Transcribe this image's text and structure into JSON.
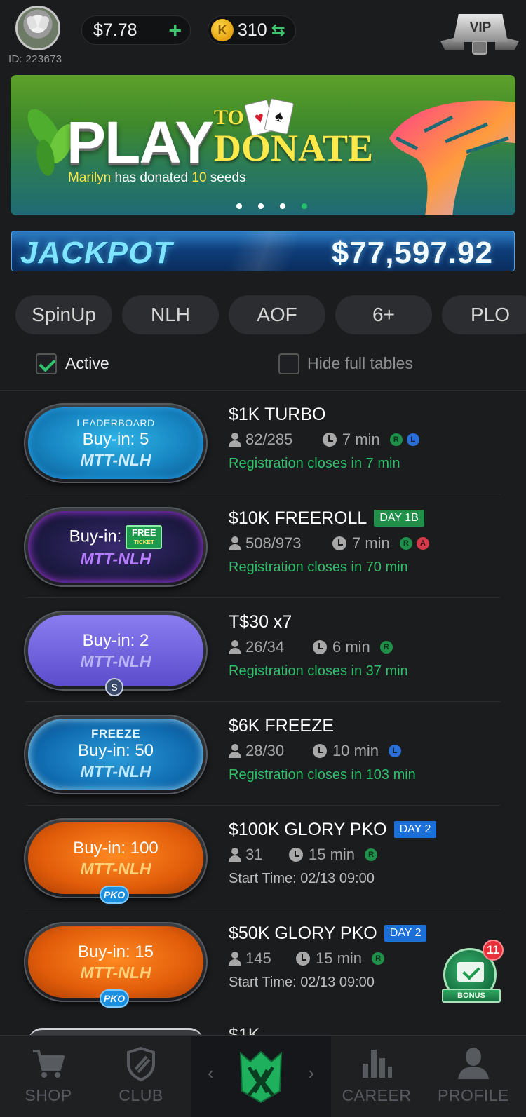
{
  "header": {
    "user_id": "ID: 223673",
    "balance": "$7.78",
    "balance_add": "+",
    "coin_symbol": "K",
    "coins": "310",
    "coins_swap": "⇆",
    "vip": "VIP"
  },
  "banner": {
    "play": "PLAY",
    "to": "TO",
    "donate": "DONATE",
    "donor_name": "Marilyn",
    "donated_text_pre": " has donated ",
    "donated_amount": "10",
    "donated_text_post": " seeds",
    "card1": "♥",
    "card2": "♠",
    "slides_total": 4,
    "active_slide": 4
  },
  "jackpot": {
    "label": "JACKPOT",
    "amount": "$77,597.92"
  },
  "filters": [
    "SpinUp",
    "NLH",
    "AOF",
    "6+",
    "PLO"
  ],
  "options": {
    "active_label": "Active",
    "active_checked": true,
    "hide_full_label": "Hide full tables",
    "hide_full_checked": false
  },
  "tournaments": [
    {
      "theme": "blue",
      "top_tag": "LEADERBOARD",
      "buy_in": "Buy-in: 5",
      "game": "MTT-NLH",
      "title": "$1K TURBO",
      "day_tag": "",
      "players": "82/285",
      "time": "7 min",
      "flags": [
        "R",
        "L"
      ],
      "status": "Registration closes in 7 min",
      "status_type": "green"
    },
    {
      "theme": "neon",
      "buy_in": "Buy-in:",
      "ticket": "FREE",
      "ticket_sub": "TICKET",
      "game": "MTT-NLH",
      "title": "$10K FREEROLL",
      "day_tag": "DAY 1B",
      "players": "508/973",
      "time": "7 min",
      "flags": [
        "R",
        "A"
      ],
      "status": "Registration closes in 70 min",
      "status_type": "green"
    },
    {
      "theme": "purple",
      "buy_in": "Buy-in: 2",
      "game": "MTT-NLH",
      "bottom_badge": "S",
      "title": "T$30 x7",
      "players": "26/34",
      "time": "6 min",
      "flags": [
        "R"
      ],
      "status": "Registration closes in 37 min",
      "status_type": "green"
    },
    {
      "theme": "freeze",
      "top_tag": "FREEZE",
      "buy_in": "Buy-in: 50",
      "game": "MTT-NLH",
      "title": "$6K FREEZE",
      "players": "28/30",
      "time": "10 min",
      "flags": [
        "L"
      ],
      "status": "Registration closes in 103 min",
      "status_type": "green"
    },
    {
      "theme": "orange",
      "buy_in": "Buy-in: 100",
      "game": "MTT-NLH",
      "bottom_badge": "PKO",
      "title": "$100K GLORY PKO",
      "day_tag": "DAY 2",
      "players": "31",
      "time": "15 min",
      "flags": [
        "R"
      ],
      "status": "Start Time: 02/13 09:00",
      "status_type": "grey"
    },
    {
      "theme": "orange",
      "buy_in": "Buy-in: 15",
      "game": "MTT-NLH",
      "bottom_badge": "PKO",
      "title": "$50K GLORY PKO",
      "day_tag": "DAY 2",
      "players": "145",
      "time": "15 min",
      "flags": [
        "R"
      ],
      "status": "Start Time: 02/13 09:00",
      "status_type": "grey"
    }
  ],
  "partial_row": {
    "title": "$1K"
  },
  "bonus": {
    "label": "BONUS",
    "count": "11"
  },
  "nav": {
    "shop": "SHOP",
    "club": "CLUB",
    "career": "CAREER",
    "profile": "PROFILE",
    "left_arrow": "‹",
    "right_arrow": "›"
  },
  "colors": {
    "accent_green": "#2fbf6a",
    "background": "#1b1c1e",
    "day_green": "#1f8f4a",
    "day_blue": "#1b6fd6"
  }
}
